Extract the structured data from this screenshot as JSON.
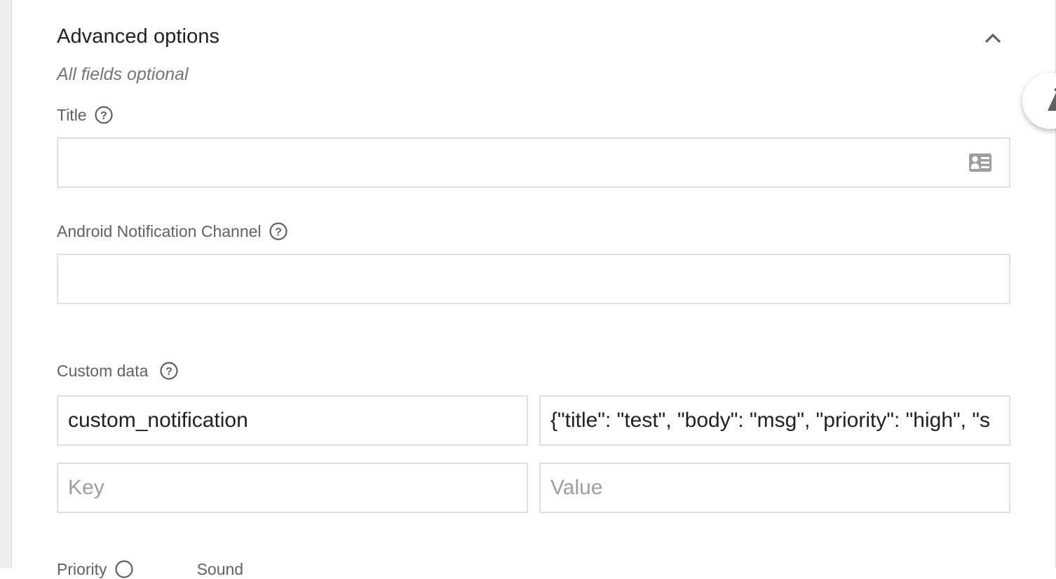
{
  "section": {
    "title": "Advanced options",
    "subtitle": "All fields optional",
    "collapse_icon": "chevron-up-icon"
  },
  "fields": {
    "title": {
      "label": "Title",
      "value": "",
      "placeholder": "",
      "help_icon": "help-circle-icon",
      "trailing_icon": "contact-card-icon"
    },
    "android_channel": {
      "label": "Android Notification Channel",
      "value": "",
      "placeholder": "",
      "help_icon": "help-circle-icon"
    },
    "custom_data": {
      "label": "Custom data",
      "help_icon": "help-circle-icon",
      "rows": [
        {
          "key": "custom_notification",
          "value": "{\"title\": \"test\", \"body\": \"msg\", \"priority\": \"high\", \"s",
          "key_placeholder": "Key",
          "value_placeholder": "Value"
        },
        {
          "key": "",
          "value": "",
          "key_placeholder": "Key",
          "value_placeholder": "Value"
        }
      ]
    },
    "next_label_partial": {
      "label": "Priority",
      "extra": "Sound"
    }
  },
  "floating_button": {
    "icon": "feedback-triangle-icon"
  }
}
